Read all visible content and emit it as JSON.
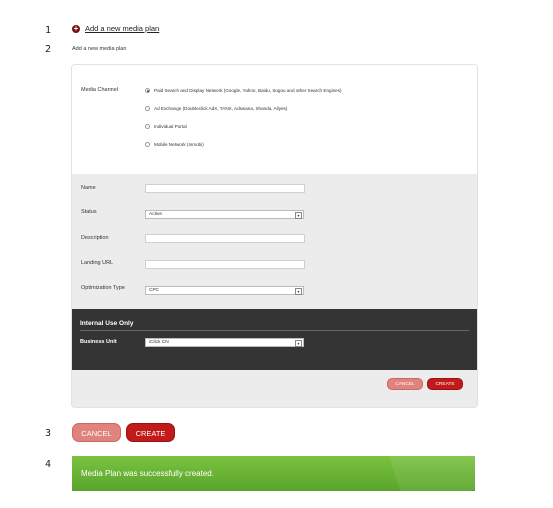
{
  "steps": [
    "1",
    "2",
    "3",
    "4"
  ],
  "header": {
    "add_link_label": "Add a new media plan",
    "subtitle": "Add a new media plan"
  },
  "form": {
    "media_channel_label": "Media Channel",
    "media_channel_options": [
      "Paid Search and Display Network (Google, Yahoo, Baidu, Sogou and other Search Engines)",
      "Ad Exchange (Doubleclick AdX, TANX, Adswana, Shanda, Allyes)",
      "Individual Portal",
      "Mobile Network (Inmobi)"
    ],
    "media_channel_selected": 0,
    "name_label": "Name",
    "name_value": "",
    "status_label": "Status",
    "status_value": "Active",
    "description_label": "Description",
    "description_value": "",
    "landing_url_label": "Landing URL",
    "landing_url_value": "",
    "optimization_type_label": "Optimization Type",
    "optimization_type_value": "CPC"
  },
  "internal": {
    "title": "Internal Use Only",
    "business_unit_label": "Business Unit",
    "business_unit_value": "iClick CN"
  },
  "buttons": {
    "cancel": "CANCEL",
    "create": "CREATE"
  },
  "success": {
    "message": "Media Plan was successfully created."
  },
  "colors": {
    "primary_red": "#c21a1a",
    "cancel_pink": "#e0837c",
    "success_green": "#6bb536",
    "dark_panel": "#343434"
  }
}
